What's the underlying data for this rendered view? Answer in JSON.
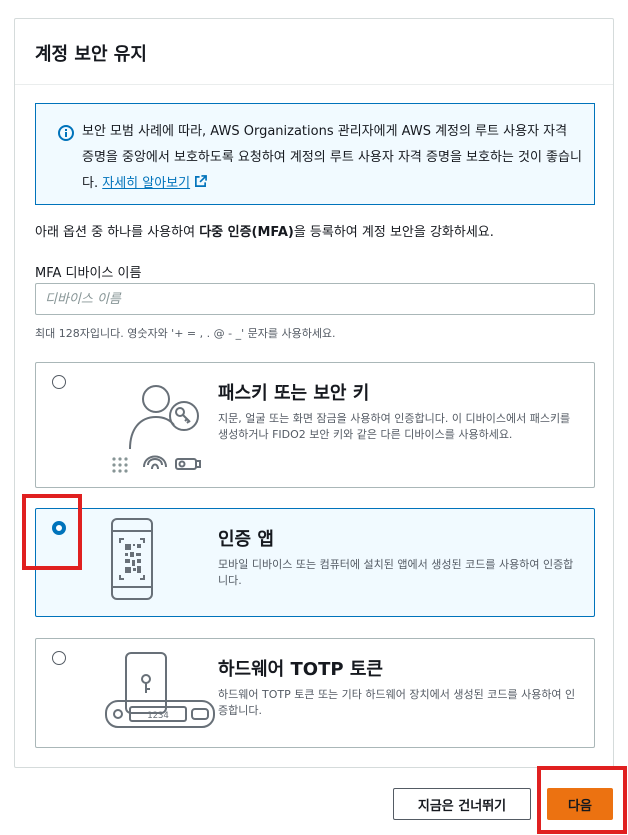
{
  "card": {
    "title": "계정 보안 유지"
  },
  "info": {
    "text": "보안 모범 사례에 따라, AWS Organizations 관리자에게 AWS 계정의 루트 사용자 자격 증명을 중앙에서 보호하도록 요청하여 계정의 루트 사용자 자격 증명을 보호하는 것이 좋습니다.",
    "link": "자세히 알아보기"
  },
  "intro": {
    "before": "아래 옵션 중 하나를 사용하여 ",
    "bold": "다중 인증(MFA)",
    "after": "을 등록하여 계정 보안을 강화하세요."
  },
  "device_name": {
    "label": "MFA 디바이스 이름",
    "placeholder": "디바이스 이름",
    "value": "",
    "constraint": "최대 128자입니다. 영숫자와 '+ = , . @ - _' 문자를 사용하세요."
  },
  "options": [
    {
      "title": "패스키 또는 보안 키",
      "description": "지문, 얼굴 또는 화면 잠금을 사용하여 인증합니다. 이 디바이스에서 패스키를 생성하거나 FIDO2 보안 키와 같은 다른 디바이스를 사용하세요.",
      "selected": false
    },
    {
      "title": "인증 앱",
      "description": "모바일 디바이스 또는 컴퓨터에 설치된 앱에서 생성된 코드를 사용하여 인증합니다.",
      "selected": true
    },
    {
      "title": "하드웨어 TOTP 토큰",
      "description": "하드웨어 TOTP 토큰 또는 기타 하드웨어 장치에서 생성된 코드를 사용하여 인증합니다.",
      "selected": false,
      "token_display": "1234"
    }
  ],
  "footer": {
    "skip_label": "지금은 건너뛰기",
    "next_label": "다음"
  },
  "colors": {
    "accent": "#0073bb",
    "primary_button": "#ec7211",
    "annotation": "#e02020"
  }
}
